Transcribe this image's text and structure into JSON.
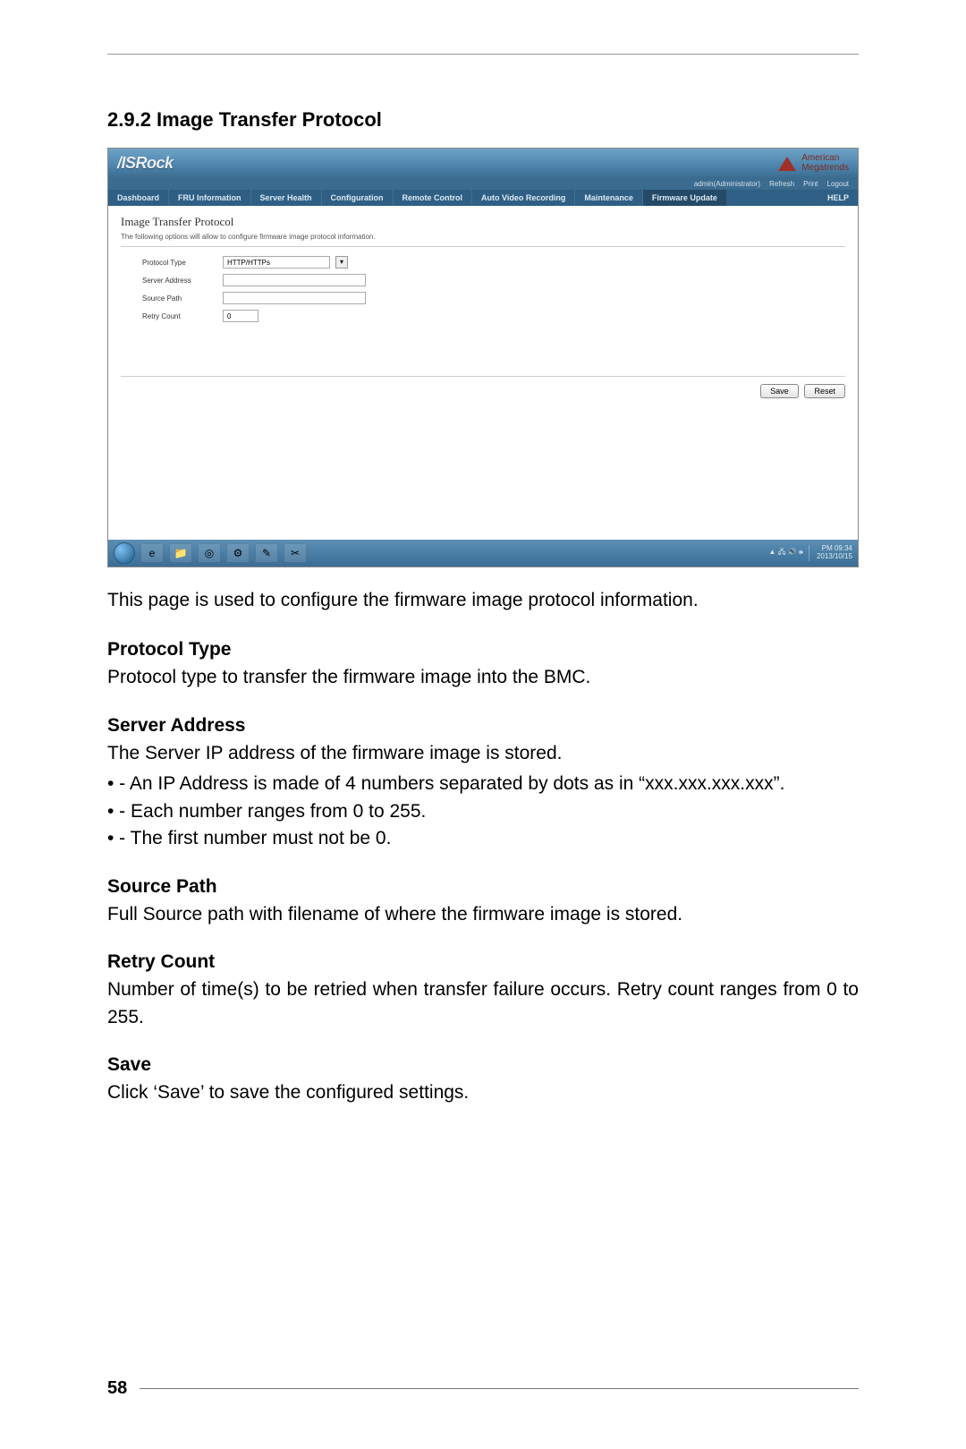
{
  "doc": {
    "section_heading": "2.9.2  Image Transfer Protocol",
    "intro": "This page is used to configure the firmware image protocol information.",
    "protocol_type_h": "Protocol Type",
    "protocol_type_p": "Protocol type to transfer the firmware image into the BMC.",
    "server_addr_h": "Server Address",
    "server_addr_p": "The Server IP address of the firmware image is stored.",
    "server_addr_b1": "An IP Address is made of 4 numbers separated by dots as in “xxx.xxx.xxx.xxx”.",
    "server_addr_b2": "Each number ranges from 0 to 255.",
    "server_addr_b3": "The first number must not be 0.",
    "source_path_h": "Source Path",
    "source_path_p": "Full Source path with filename of where the firmware image is stored.",
    "retry_h": "Retry Count",
    "retry_p": "Number of time(s) to be retried when transfer failure occurs. Retry count ranges from 0 to 255.",
    "save_h": "Save",
    "save_p": "Click ‘Save’ to save the configured settings.",
    "page_number": "58"
  },
  "screenshot": {
    "brand": "/ISRock",
    "ami_top": "American",
    "ami_bottom": "Megatrends",
    "userbar": {
      "user": "admin(Administrator)",
      "refresh": "Refresh",
      "print": "Print",
      "logout": "Logout"
    },
    "nav": {
      "dashboard": "Dashboard",
      "fru": "FRU Information",
      "server_health": "Server Health",
      "configuration": "Configuration",
      "remote": "Remote Control",
      "avr": "Auto Video Recording",
      "maintenance": "Maintenance",
      "fw": "Firmware Update",
      "help": "HELP"
    },
    "page_title": "Image Transfer Protocol",
    "description": "The following options will allow to configure firmware image protocol information.",
    "form": {
      "protocol_label": "Protocol Type",
      "protocol_value": "HTTP/HTTPs",
      "server_label": "Server Address",
      "server_value": "",
      "source_label": "Source Path",
      "source_value": "",
      "retry_label": "Retry Count",
      "retry_value": "0"
    },
    "buttons": {
      "save": "Save",
      "reset": "Reset"
    },
    "taskbar": {
      "tray_icons": "▲ 🖧 🔊 🕪",
      "time": "PM 09:34",
      "date": "2013/10/15"
    }
  }
}
